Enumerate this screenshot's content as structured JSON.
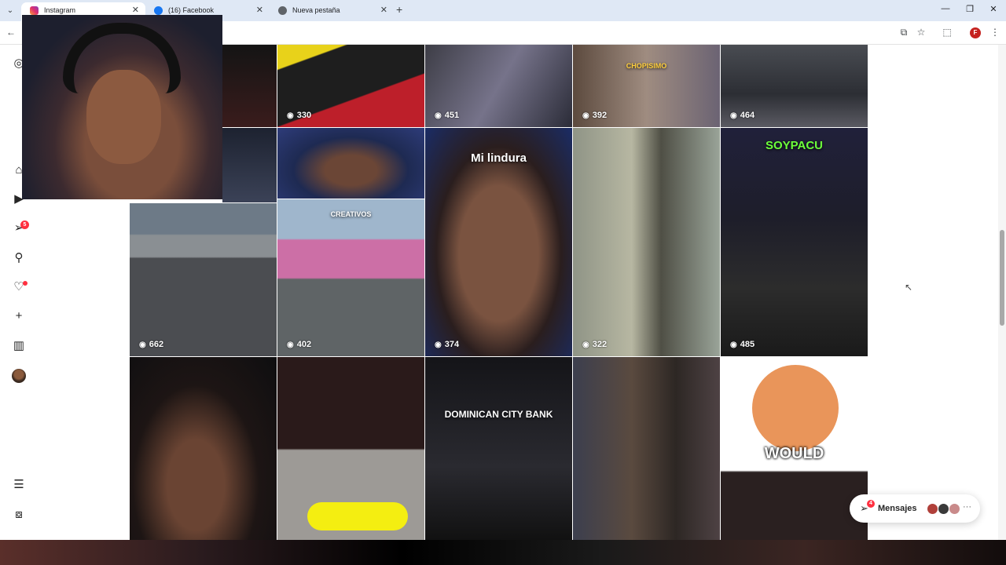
{
  "browser": {
    "tabs": [
      {
        "title": "Instagram",
        "active": true,
        "favicon": "instagram-icon"
      },
      {
        "title": "(16) Facebook",
        "active": false,
        "favicon": "facebook-icon"
      },
      {
        "title": "Nueva pestaña",
        "active": false,
        "favicon": "chrome-icon"
      }
    ],
    "new_tab": "+",
    "profile_initial": "F"
  },
  "nav": {
    "items": [
      "home-icon",
      "reels-icon",
      "messages-icon",
      "search-icon",
      "notifications-icon",
      "create-icon",
      "stats-icon",
      "profile-avatar",
      "menu-icon",
      "more-apps-icon"
    ],
    "messages_badge": "5"
  },
  "grid": {
    "tiles": [
      {
        "views": "330",
        "caption": ""
      },
      {
        "views": "451",
        "caption": ""
      },
      {
        "views": "392",
        "caption": "CHOPISIMO"
      },
      {
        "views": "464",
        "caption": ""
      },
      {
        "views": "",
        "caption": ""
      },
      {
        "views": "",
        "caption": "CREATIVOS"
      },
      {
        "views": "374",
        "caption": "Mi lindura"
      },
      {
        "views": "322",
        "caption": ""
      },
      {
        "views": "485",
        "caption": "SOYPACU"
      },
      {
        "views": "662",
        "caption": ""
      },
      {
        "views": "402",
        "caption": ""
      },
      {
        "views": "",
        "caption": "DOMINICAN CITY BANK"
      },
      {
        "views": "",
        "caption": "WOULD"
      },
      {
        "views": "",
        "caption": "CREATIVOS"
      }
    ]
  },
  "messages": {
    "label": "Mensajes",
    "badge": "4"
  }
}
